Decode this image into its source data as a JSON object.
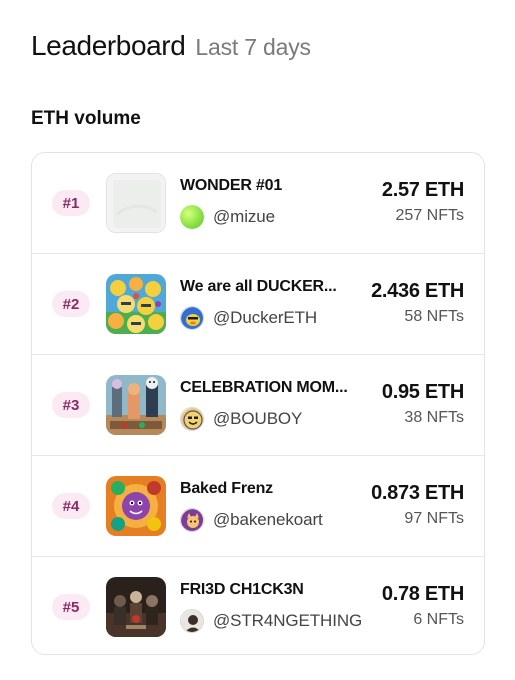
{
  "header": {
    "title": "Leaderboard",
    "subtitle": "Last 7 days"
  },
  "section": {
    "label": "ETH volume"
  },
  "rows": [
    {
      "rank": "#1",
      "name": "WONDER #01",
      "handle": "@mizue",
      "eth": "2.57 ETH",
      "nfts": "257 NFTs",
      "thumb_icon": "blank-artwork",
      "avatar_icon": "green-gradient-avatar"
    },
    {
      "rank": "#2",
      "name": "We are all DUCKER...",
      "handle": "@DuckerETH",
      "eth": "2.436 ETH",
      "nfts": "58 NFTs",
      "thumb_icon": "ducks-artwork",
      "avatar_icon": "duck-avatar"
    },
    {
      "rank": "#3",
      "name": "CELEBRATION MOM...",
      "handle": "@BOUBOY",
      "eth": "0.95 ETH",
      "nfts": "38 NFTs",
      "thumb_icon": "celebration-artwork",
      "avatar_icon": "smiley-avatar"
    },
    {
      "rank": "#4",
      "name": "Baked Frenz",
      "handle": "@bakenekoart",
      "eth": "0.873 ETH",
      "nfts": "97 NFTs",
      "thumb_icon": "baked-frenz-artwork",
      "avatar_icon": "purple-cat-avatar"
    },
    {
      "rank": "#5",
      "name": "FRI3D CH1CK3N",
      "handle": "@STR4NGETHING",
      "eth": "0.78 ETH",
      "nfts": "6 NFTs",
      "thumb_icon": "dark-scene-artwork",
      "avatar_icon": "dark-portrait-avatar"
    }
  ],
  "colors": {
    "rank_bg": "#fbeaf4",
    "rank_text": "#8a2a66",
    "subtitle": "#7a7a7a",
    "border": "#e3e3e3"
  }
}
